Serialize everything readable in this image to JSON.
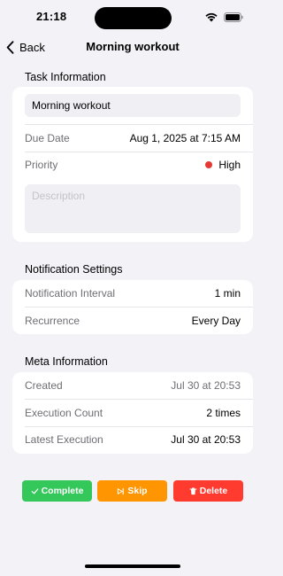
{
  "status": {
    "time": "21:18"
  },
  "nav": {
    "back_label": "Back",
    "title": "Morning workout"
  },
  "task_info": {
    "header": "Task Information",
    "title_value": "Morning workout",
    "due_date_label": "Due Date",
    "due_date_value": "Aug 1, 2025 at 7:15 AM",
    "priority_label": "Priority",
    "priority_value": "High",
    "priority_color": "#e53935",
    "description_placeholder": "Description"
  },
  "notification": {
    "header": "Notification Settings",
    "interval_label": "Notification Interval",
    "interval_value": "1 min",
    "recurrence_label": "Recurrence",
    "recurrence_value": "Every Day"
  },
  "meta": {
    "header": "Meta Information",
    "created_label": "Created",
    "created_value": "Jul 30 at 20:53",
    "execution_count_label": "Execution Count",
    "execution_count_value": "2 times",
    "latest_execution_label": "Latest Execution",
    "latest_execution_value": "Jul 30 at 20:53"
  },
  "actions": {
    "complete_label": "Complete",
    "complete_color": "#34c759",
    "skip_label": "Skip",
    "skip_color": "#ff9500",
    "delete_label": "Delete",
    "delete_color": "#ff3b30"
  },
  "icons": {
    "back": "chevron-left-icon",
    "complete": "checkmark-icon",
    "skip": "skip-forward-icon",
    "delete": "trash-icon",
    "wifi": "wifi-icon",
    "battery": "battery-icon"
  }
}
